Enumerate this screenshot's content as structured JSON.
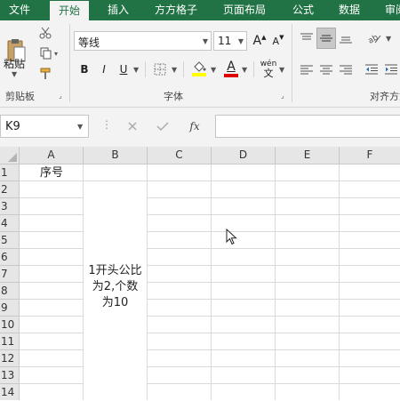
{
  "tabs": [
    "文件",
    "开始",
    "插入",
    "方方格子",
    "页面布局",
    "公式",
    "数据",
    "审阅"
  ],
  "active_tab": "开始",
  "ribbon": {
    "clipboard": {
      "paste_label": "粘贴",
      "group_label": "剪贴板"
    },
    "font": {
      "name": "等线",
      "size": "11",
      "group_label": "字体",
      "bold": "B",
      "italic": "I",
      "underline": "U",
      "grow": "A",
      "shrink": "A",
      "phonetic": "wén",
      "font_color_letter": "A"
    },
    "alignment": {
      "group_label": "对齐方式"
    },
    "colors": {
      "highlight": "#ffff00",
      "font_color": "#e00000"
    }
  },
  "formula_bar": {
    "name_box": "K9",
    "fx": "fx",
    "formula": ""
  },
  "columns": [
    "A",
    "B",
    "C",
    "D",
    "E",
    "F"
  ],
  "rows": [
    "1",
    "2",
    "3",
    "4",
    "5",
    "6",
    "7",
    "8",
    "9",
    "10",
    "11",
    "12",
    "13",
    "14"
  ],
  "cells": {
    "A1": "序号",
    "B2_B14": "1开头公比为2,个数为10"
  }
}
